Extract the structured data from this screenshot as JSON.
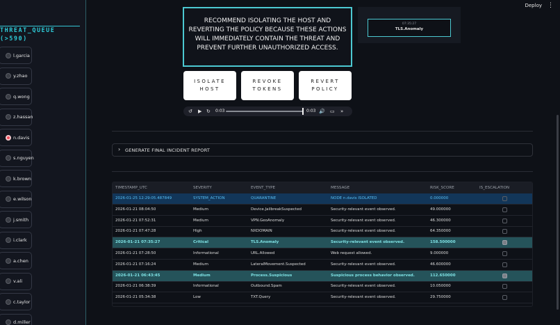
{
  "sidebar": {
    "queue_title": "THREAT_QUEUE\n(>590)",
    "users": [
      "l.garcia",
      "y.zhao",
      "q.wong",
      "z.hassan",
      "n.davis",
      "s.nguyen",
      "k.brown",
      "e.wilson",
      "j.smith",
      "i.clark",
      "a.chen",
      "v.ali",
      "c.taylor",
      "d.miller"
    ],
    "alert_user": "n.davis",
    "alert_color": "#ef4b5a"
  },
  "topbar": {
    "deploy_label": "Deploy",
    "menu_icon": "kebab-menu-icon"
  },
  "recommendation": {
    "text": "RECOMMEND ISOLATING THE HOST AND REVERTING THE POLICY BECAUSE THESE ACTIONS WILL IMMEDIATELY CONTAIN THE THREAT AND PREVENT FURTHER UNAUTHORIZED ACCESS.",
    "accent": "#4cc9d2"
  },
  "side_panel": {
    "time": "07:35:27",
    "event": "TLS.Anomaly"
  },
  "actions": {
    "isolate_host": "ISOLATE\nHOST",
    "revoke_tokens": "REVOKE\nTOKENS",
    "revert_policy": "REVERT\nPOLICY"
  },
  "player": {
    "current_time": "0:03",
    "duration": "0:03",
    "progress": 1.0,
    "icons": [
      "rewind-icon",
      "play-icon",
      "forward-icon",
      "volume-icon",
      "cast-icon",
      "skip-icon"
    ]
  },
  "expander": {
    "label": "GENERATE FINAL INCIDENT REPORT"
  },
  "table": {
    "columns": [
      "TIMESTAMP_UTC",
      "SEVERITY",
      "EVENT_TYPE",
      "MESSAGE",
      "RISK_SCORE",
      "IS_ESCALATION"
    ],
    "rows": [
      {
        "ts": "2026-01-25 12:29:05.487849",
        "sev": "SYSTEM_ACTION",
        "evt": "QUARANTINE",
        "msg": "NODE n.davis ISOLATED",
        "risk": "0.000000",
        "esc": false,
        "style": "blue"
      },
      {
        "ts": "2026-01-21 08:04:50",
        "sev": "Medium",
        "evt": "Device.JailbreakSuspected",
        "msg": "Security-relevant event observed.",
        "risk": "49.000000",
        "esc": false,
        "style": ""
      },
      {
        "ts": "2026-01-21 07:52:31",
        "sev": "Medium",
        "evt": "VPN.GeoAnomaly",
        "msg": "Security-relevant event observed.",
        "risk": "46.300000",
        "esc": false,
        "style": ""
      },
      {
        "ts": "2026-01-21 07:47:28",
        "sev": "High",
        "evt": "NXDOMAIN",
        "msg": "Security-relevant event observed.",
        "risk": "64.350000",
        "esc": false,
        "style": ""
      },
      {
        "ts": "2026-01-21 07:35:27",
        "sev": "Critical",
        "evt": "TLS.Anomaly",
        "msg": "Security-relevant event observed.",
        "risk": "158.500000",
        "esc": true,
        "style": "teal"
      },
      {
        "ts": "2026-01-21 07:28:50",
        "sev": "Informational",
        "evt": "URL.Allowed",
        "msg": "Web request allowed.",
        "risk": "9.000000",
        "esc": false,
        "style": ""
      },
      {
        "ts": "2026-01-21 07:16:24",
        "sev": "Medium",
        "evt": "LateralMovement.Suspected",
        "msg": "Security-relevant event observed.",
        "risk": "46.600000",
        "esc": false,
        "style": ""
      },
      {
        "ts": "2026-01-21 06:43:45",
        "sev": "Medium",
        "evt": "Process.Suspicious",
        "msg": "Suspicious process behavior observed.",
        "risk": "112.650000",
        "esc": true,
        "style": "teal"
      },
      {
        "ts": "2026-01-21 06:38:39",
        "sev": "Informational",
        "evt": "Outbound.Spam",
        "msg": "Security-relevant event observed.",
        "risk": "10.050000",
        "esc": false,
        "style": ""
      },
      {
        "ts": "2026-01-21 05:34:38",
        "sev": "Low",
        "evt": "TXT.Query",
        "msg": "Security-relevant event observed.",
        "risk": "29.750000",
        "esc": false,
        "style": ""
      }
    ]
  }
}
